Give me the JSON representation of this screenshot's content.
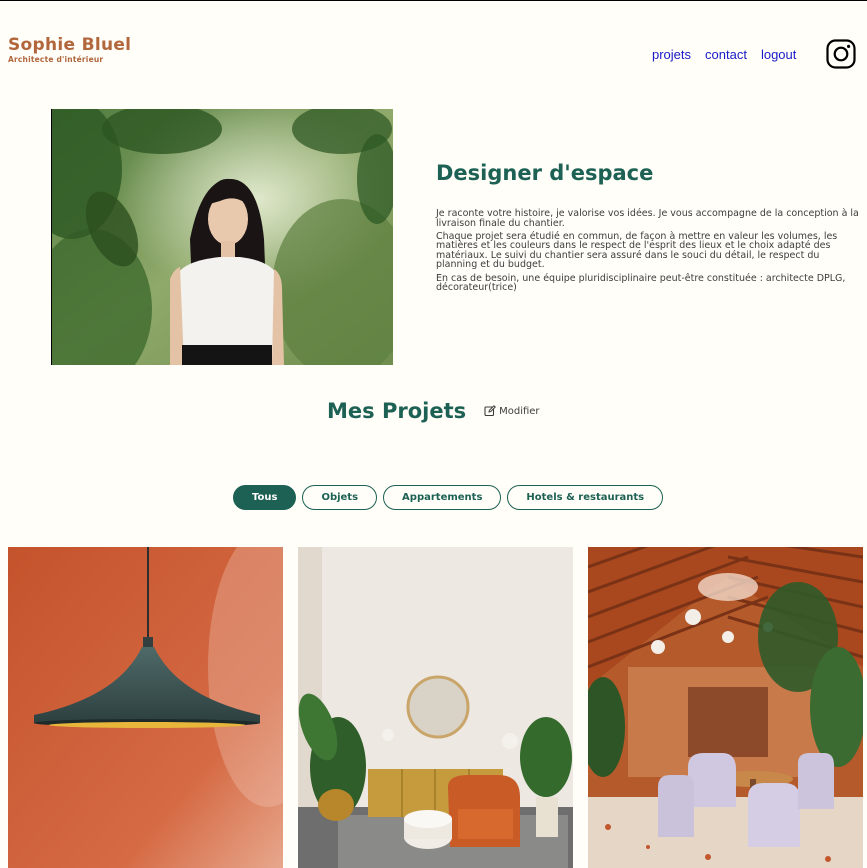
{
  "header": {
    "logo_title": "Sophie Bluel",
    "logo_subtitle": "Architecte d'intérieur",
    "nav": [
      "projets",
      "contact",
      "logout"
    ],
    "social_icon": "instagram-icon"
  },
  "intro": {
    "title": "Designer d'espace",
    "paragraphs": [
      "Je raconte votre histoire, je valorise vos idées. Je vous accompagne de la conception à la livraison finale du chantier.",
      "Chaque projet sera étudié en commun, de façon à mettre en valeur les volumes, les matières et les couleurs dans le respect de l'esprit des lieux et le choix adapté des matériaux. Le suivi du chantier sera assuré dans le souci du détail, le respect du planning et du budget.",
      "En cas de besoin, une équipe pluridisciplinaire peut-être constituée : architecte DPLG, décorateur(trice)"
    ]
  },
  "projects": {
    "title": "Mes Projets",
    "edit_label": "Modifier",
    "filters": [
      "Tous",
      "Objets",
      "Appartements",
      "Hotels & restaurants"
    ],
    "active_filter": "Tous"
  },
  "colors": {
    "brand": "#B1663C",
    "accent": "#1D6154",
    "nav_link": "#1A1AC8",
    "background": "#FFFEF8"
  }
}
